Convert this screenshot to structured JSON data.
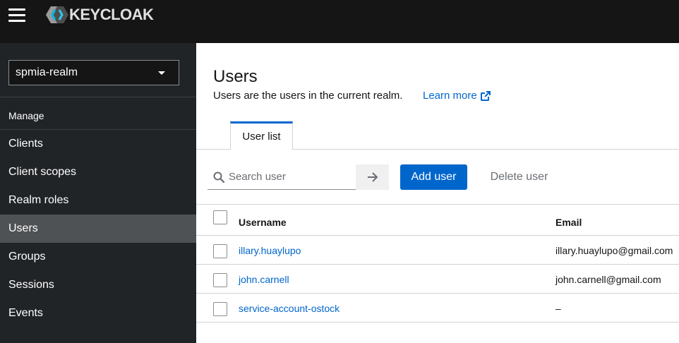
{
  "header": {
    "brand": "KEYCLOAK",
    "icons": {
      "menu": "hamburger-icon",
      "logo": "keycloak-logo"
    }
  },
  "sidebar": {
    "realm": "spmia-realm",
    "section": "Manage",
    "items": [
      {
        "label": "Clients"
      },
      {
        "label": "Client scopes"
      },
      {
        "label": "Realm roles"
      },
      {
        "label": "Users",
        "active": true
      },
      {
        "label": "Groups"
      },
      {
        "label": "Sessions"
      },
      {
        "label": "Events"
      }
    ]
  },
  "main": {
    "title": "Users",
    "description": "Users are the users in the current realm.",
    "learn_more": "Learn more",
    "tabs": [
      {
        "label": "User list",
        "active": true
      }
    ],
    "toolbar": {
      "search_placeholder": "Search user",
      "search_value": "",
      "add_user": "Add user",
      "delete_user": "Delete user"
    },
    "table": {
      "columns": [
        "Username",
        "Email"
      ],
      "rows": [
        {
          "username": "illary.huaylupo",
          "email": "illary.huaylupo@gmail.com"
        },
        {
          "username": "john.carnell",
          "email": "john.carnell@gmail.com"
        },
        {
          "username": "service-account-ostock",
          "email": "–"
        }
      ]
    }
  },
  "colors": {
    "header_bg": "#151515",
    "sidebar_bg": "#212427",
    "active_item_bg": "#4f5255",
    "accent": "#0066cc"
  }
}
